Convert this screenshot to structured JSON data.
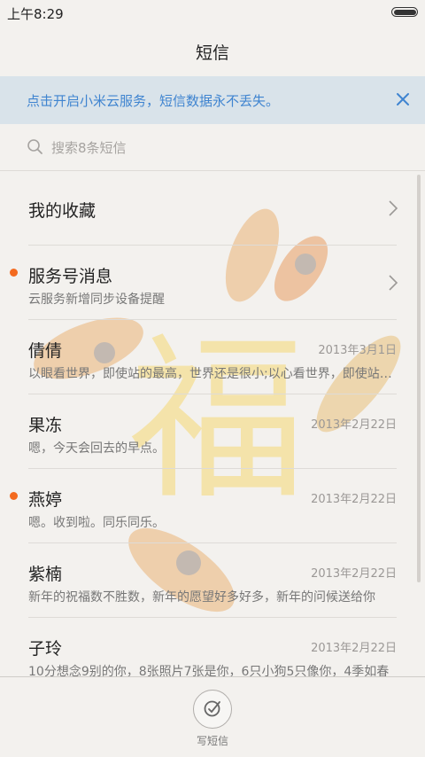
{
  "status_bar": {
    "time": "上午8:29"
  },
  "header": {
    "title": "短信"
  },
  "banner": {
    "text": "点击开启小米云服务，短信数据永不丢失。"
  },
  "search": {
    "placeholder": "搜索8条短信"
  },
  "watermark": {
    "glyph": "福"
  },
  "conversations": [
    {
      "name": "我的收藏",
      "preview": "",
      "date": "",
      "unread": false,
      "chevron": true
    },
    {
      "name": "服务号消息",
      "preview": "云服务新增同步设备提醒",
      "date": "",
      "unread": true,
      "chevron": true
    },
    {
      "name": "倩倩",
      "preview": "以眼看世界，即使站的最高，世界还是很小;以心看世界，即使站的最低，世界也很大",
      "date": "2013年3月1日",
      "unread": false,
      "chevron": false
    },
    {
      "name": "果冻",
      "preview": "嗯，今天会回去的早点。",
      "date": "2013年2月22日",
      "unread": false,
      "chevron": false
    },
    {
      "name": "燕婷",
      "preview": "嗯。收到啦。同乐同乐。",
      "date": "2013年2月22日",
      "unread": true,
      "chevron": false
    },
    {
      "name": "紫楠",
      "preview": "新年的祝福数不胜数，新年的愿望好多好多，新年的问候送给你",
      "date": "2013年2月22日",
      "unread": false,
      "chevron": false
    },
    {
      "name": "子玲",
      "preview": "10分想念9别的你，8张照片7张是你，6只小狗5只像你，4季如春",
      "date": "2013年2月22日",
      "unread": false,
      "chevron": false
    }
  ],
  "bottom_bar": {
    "compose_label": "写短信"
  },
  "colors": {
    "accent": "#3f84d0",
    "unread_dot": "#f36a1f",
    "banner_bg": "#d9e3ea",
    "background": "#f3f1ee"
  }
}
